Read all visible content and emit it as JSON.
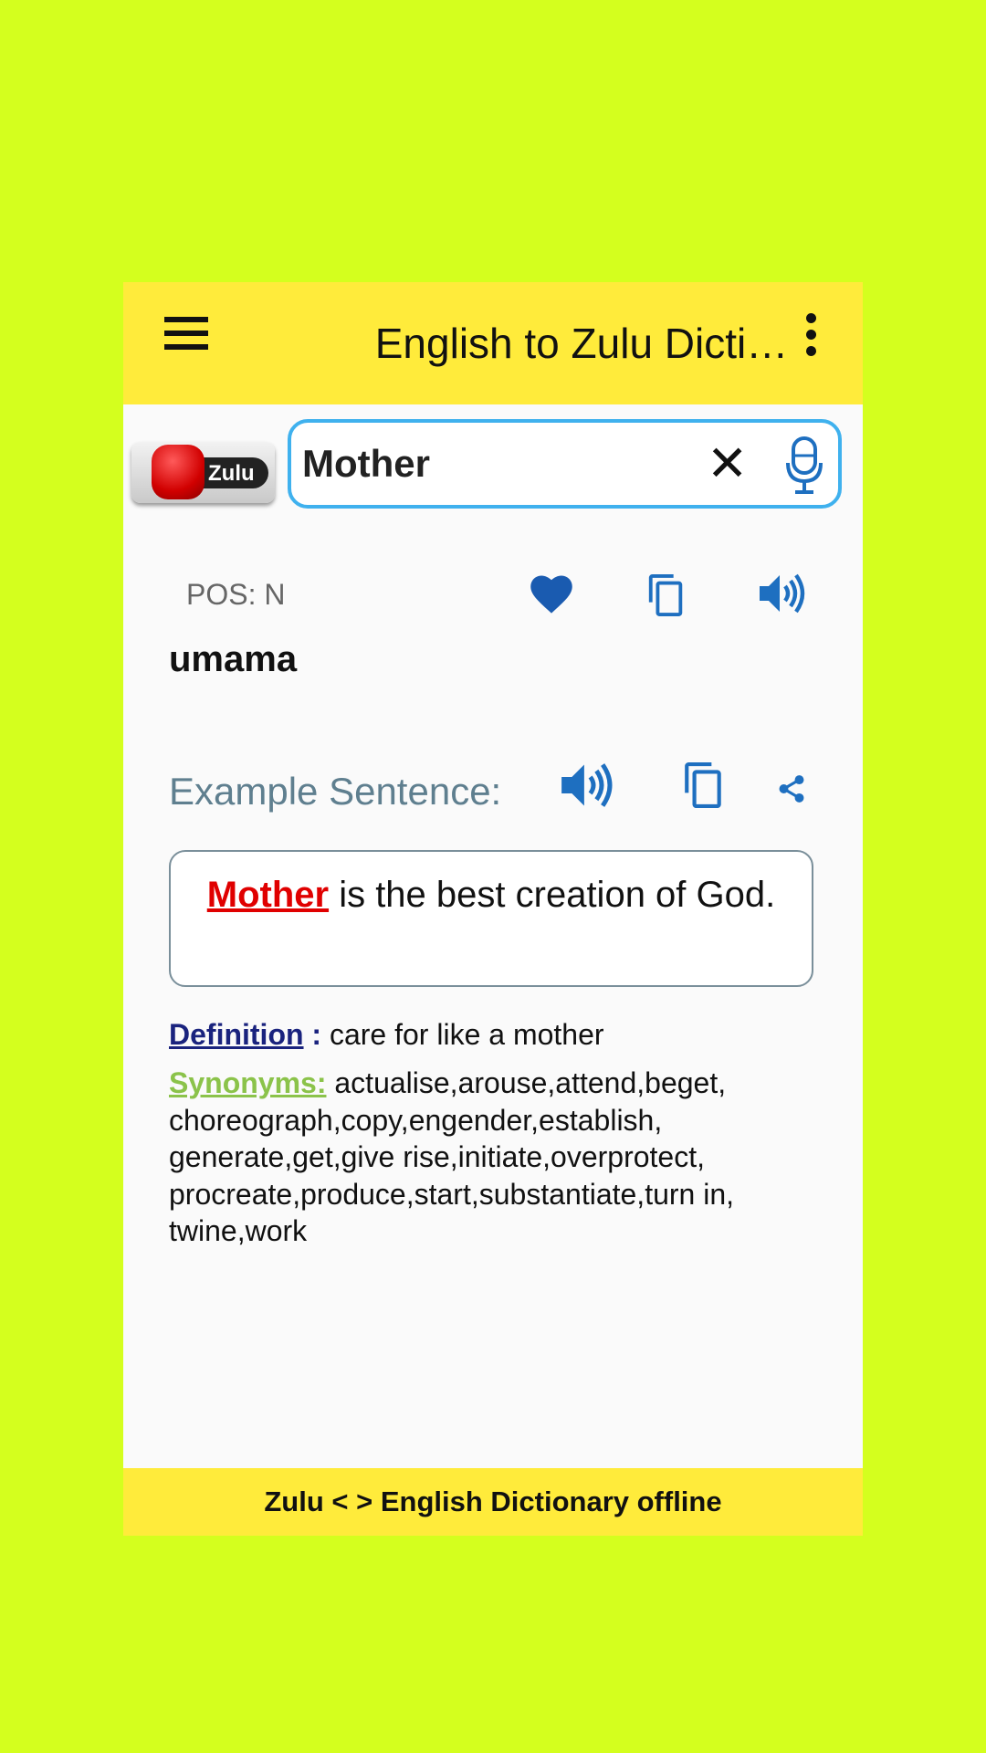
{
  "colors": {
    "background": "#d4ff1e",
    "appbar": "#ffeb3b",
    "accent_blue": "#1e6fc0",
    "search_border": "#3fb1ee",
    "highlight": "#e00000",
    "definition_label": "#1a237e",
    "synonyms_label": "#8bc34a"
  },
  "appbar": {
    "title": "English to Zulu Dicti…",
    "menu_icon": "hamburger-icon",
    "overflow_icon": "more-vert-icon"
  },
  "logo": {
    "text": "Zulu"
  },
  "search": {
    "value": "Mother",
    "clear_icon": "close-icon",
    "mic_icon": "mic-icon"
  },
  "result": {
    "pos": "POS: N",
    "translation": "umama",
    "icons": [
      "heart-icon",
      "copy-icon",
      "speaker-icon"
    ]
  },
  "example": {
    "label": "Example Sentence:",
    "highlight": "Mother",
    "rest": " is the best creation of God.",
    "icons": [
      "speaker-icon",
      "copy-icon",
      "share-icon"
    ]
  },
  "definition": {
    "label": "Definition",
    "sep": " :",
    "text": " care for like a mother"
  },
  "synonyms": {
    "label": "Synonyms:",
    "text": " actualise,arouse,attend,beget, choreograph,copy,engender,establish, generate,get,give rise,initiate,overprotect, procreate,produce,start,substantiate,turn in, twine,work"
  },
  "footer": {
    "text": "Zulu < > English Dictionary offline"
  }
}
